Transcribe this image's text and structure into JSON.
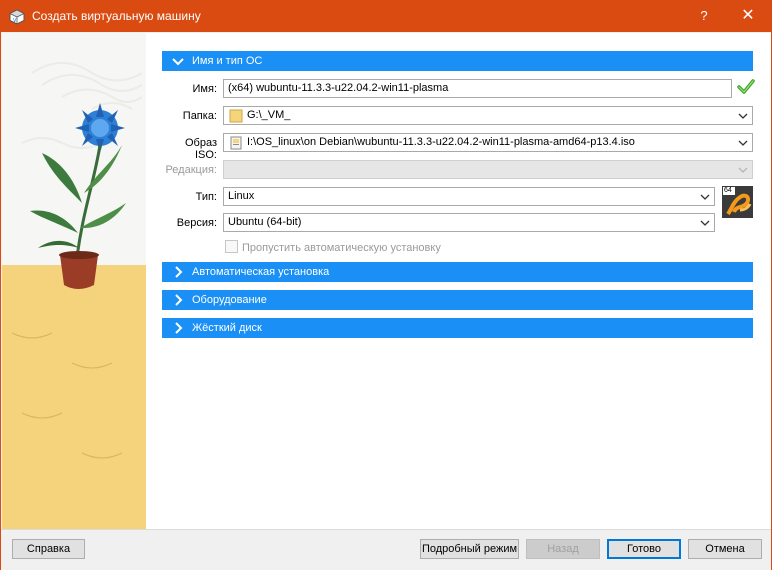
{
  "window": {
    "title": "Создать виртуальную машину",
    "help_label": "?",
    "close_label": "✕"
  },
  "sections": {
    "name_os": "Имя и тип ОС",
    "unattended": "Автоматическая установка",
    "hardware": "Оборудование",
    "disk": "Жёсткий диск"
  },
  "form": {
    "name_label": "Имя:",
    "name_value": "(x64) wubuntu-11.3.3-u22.04.2-win11-plasma",
    "folder_label": "Папка:",
    "folder_value": "G:\\_VM_",
    "iso_label": "Образ ISO:",
    "iso_value": "I:\\OS_linux\\on Debian\\wubuntu-11.3.3-u22.04.2-win11-plasma-amd64-p13.4.iso",
    "edition_label": "Редакция:",
    "edition_value": "",
    "type_label": "Тип:",
    "type_value": "Linux",
    "version_label": "Версия:",
    "version_value": "Ubuntu (64-bit)",
    "skip_unattended_label": "Пропустить автоматическую установку",
    "skip_unattended_checked": false,
    "os_badge": "64"
  },
  "buttons": {
    "help": "Справка",
    "expert": "Подробный режим",
    "back": "Назад",
    "finish": "Готово",
    "cancel": "Отмена"
  },
  "colors": {
    "titlebar": "#da4b12",
    "section_header": "#1a8ff5",
    "valid_check": "#3fa52c"
  }
}
